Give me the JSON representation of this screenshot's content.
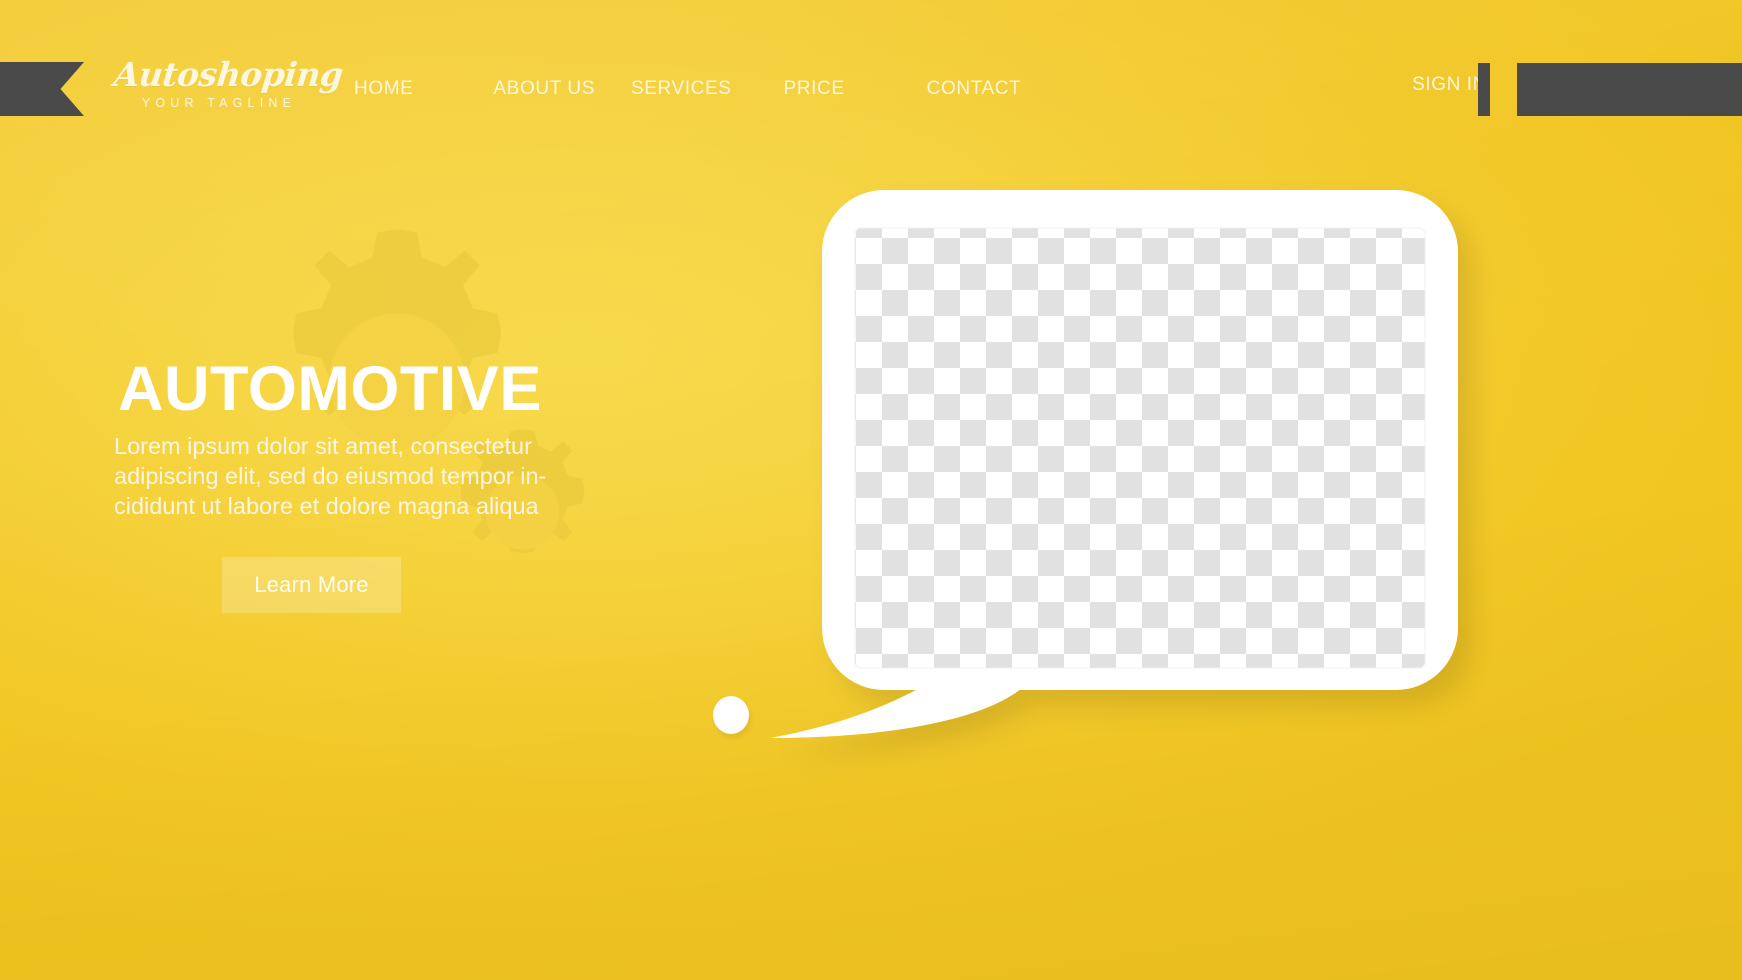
{
  "brand": {
    "name": "Autoshoping",
    "tagline": "YOUR TAGLINE",
    "ribbon_icon": "ribbon-flag-icon"
  },
  "nav": {
    "items": [
      {
        "label": "HOME"
      },
      {
        "label": "ABOUT US"
      },
      {
        "label": "SERVICES"
      },
      {
        "label": "PRICE"
      },
      {
        "label": "CONTACT"
      }
    ],
    "signin_label": "SIGN IN"
  },
  "hero": {
    "title": "AUTOMOTIVE",
    "paragraph_lines": [
      "Lorem ipsum dolor sit amet, consectetur",
      "adipiscing elit, sed do eiusmod tempor in-",
      "cididunt ut labore et dolore magna aliqua"
    ],
    "cta_label": "Learn More"
  },
  "media": {
    "placeholder_name": "image-placeholder-checkerboard",
    "bubble_name": "speech-bubble"
  },
  "colors": {
    "background_light": "#f7d94a",
    "background_mid": "#f4cd32",
    "background_dark": "#f0c41f",
    "accent_dark": "#4a4a4a",
    "text_light": "#fdf6dd",
    "heading_white": "#ffffff",
    "bubble_white": "#ffffff",
    "checker_gray": "#e0e0e0"
  }
}
